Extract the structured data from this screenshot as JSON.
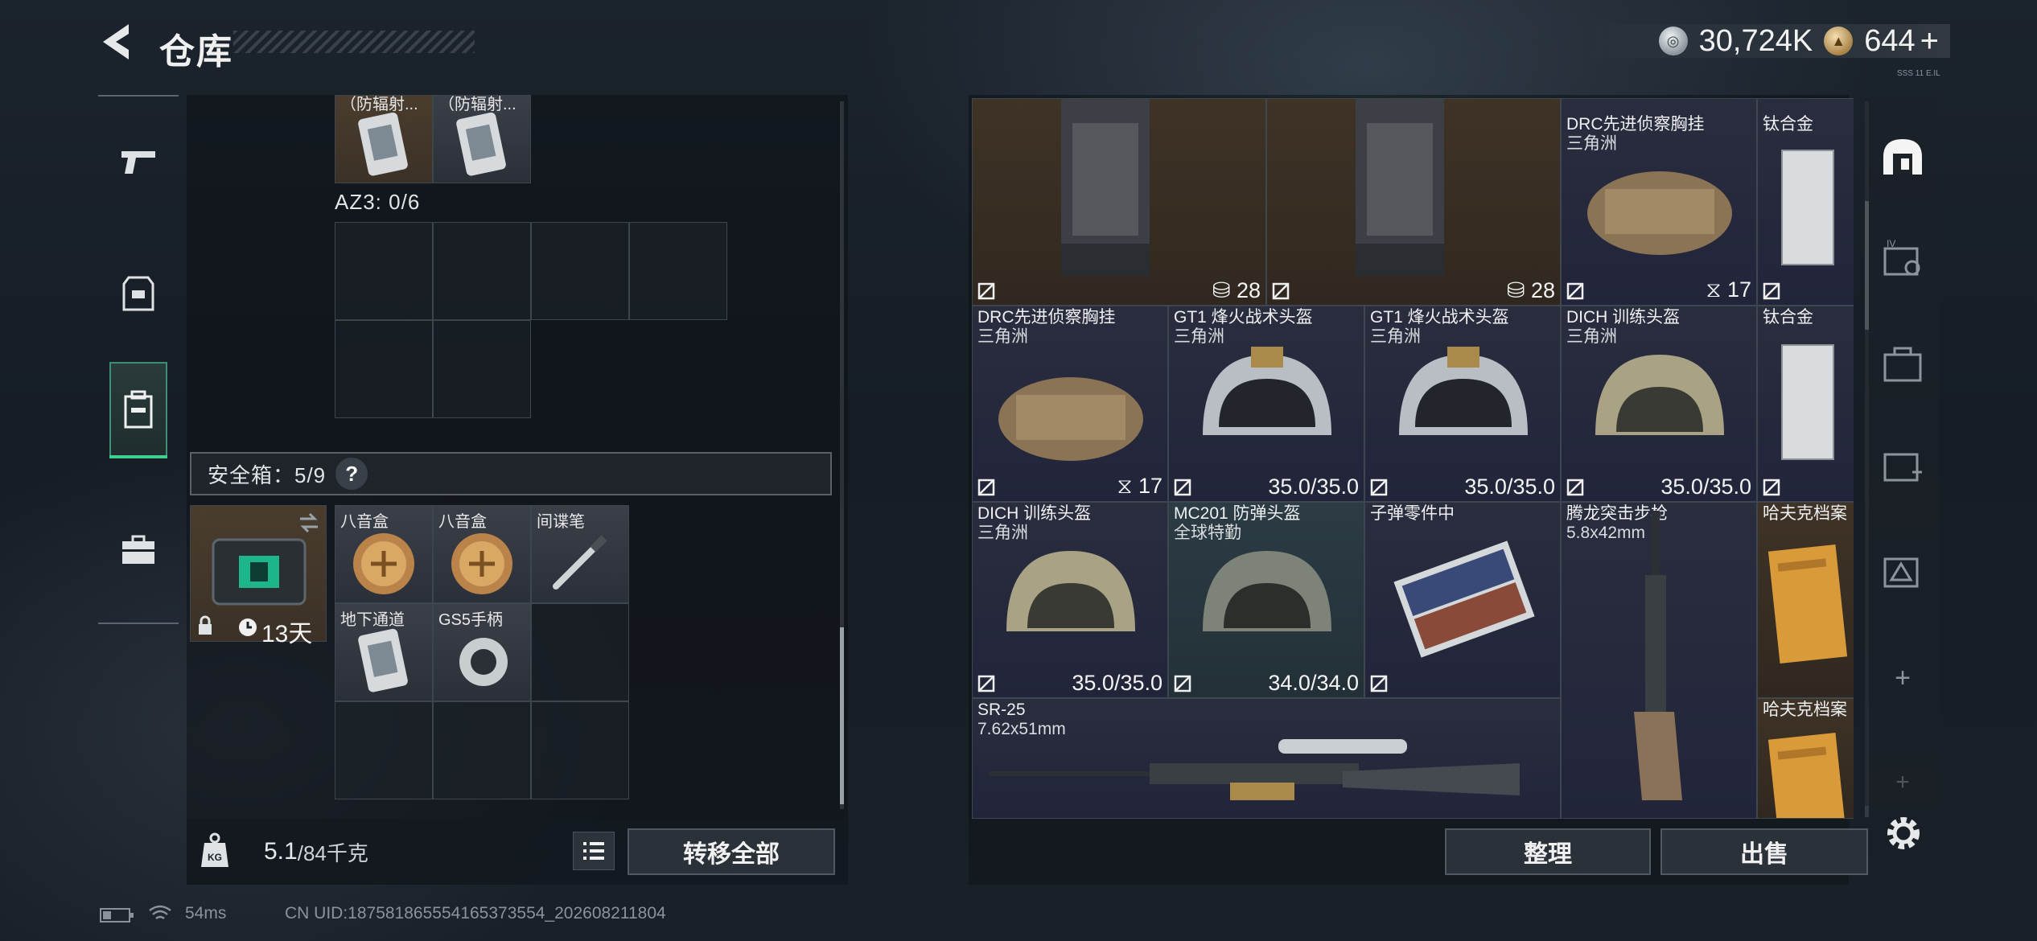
{
  "header": {
    "title": "仓库",
    "silver_amount": "30,724K",
    "gold_amount": "644",
    "gold_plus": "+",
    "tiny_note": "SSS 11 E.IL"
  },
  "left_nav": {
    "items": [
      {
        "name": "weapon",
        "icon": "pistol-icon"
      },
      {
        "name": "gear",
        "icon": "armor-icon"
      },
      {
        "name": "backpack",
        "icon": "backpack-icon",
        "active": true
      },
      {
        "name": "case",
        "icon": "briefcase-icon"
      }
    ]
  },
  "left_panel": {
    "top_items": [
      {
        "label": "（防辐射...",
        "icon": "document-card-icon"
      },
      {
        "label": "（防辐射...",
        "icon": "document-card-icon"
      }
    ],
    "az3_label": "AZ3: 0/6",
    "safebox": {
      "label": "安全箱：5/9",
      "help": "?",
      "timer": "13天",
      "items": [
        {
          "label": "八音盒",
          "icon": "music-box-icon"
        },
        {
          "label": "八音盒",
          "icon": "music-box-icon"
        },
        {
          "label": "间谍笔",
          "icon": "spy-pen-icon"
        },
        {
          "label": "地下通道",
          "icon": "document-card-icon"
        },
        {
          "label": "GS5手柄",
          "icon": "gamepad-icon"
        }
      ]
    },
    "weight": {
      "current": "5.1",
      "max": "/84千克"
    },
    "transfer_all": "转移全部"
  },
  "inventory": {
    "items": {
      "vest_a_stat": "28",
      "vest_b_stat": "28",
      "drc_top": {
        "name": "DRC先进侦察胸挂",
        "sub": "三角洲",
        "stat": "17"
      },
      "titanium_top": {
        "name": "钛合金"
      },
      "drc_mid": {
        "name": "DRC先进侦察胸挂",
        "sub": "三角洲",
        "stat": "17"
      },
      "gt1_a": {
        "name": "GT1 烽火战术头盔",
        "sub": "三角洲",
        "stat": "35.0/35.0"
      },
      "gt1_b": {
        "name": "GT1 烽火战术头盔",
        "sub": "三角洲",
        "stat": "35.0/35.0"
      },
      "dich_a": {
        "name": "DICH 训练头盔",
        "sub": "三角洲",
        "stat": "35.0/35.0"
      },
      "titanium_mid": {
        "name": "钛合金"
      },
      "dich_b": {
        "name": "DICH 训练头盔",
        "sub": "三角洲",
        "stat": "35.0/35.0"
      },
      "mc201": {
        "name": "MC201 防弹头盔",
        "sub": "全球特勤",
        "stat": "34.0/34.0"
      },
      "bullet_parts": {
        "name": "子弹零件中"
      },
      "tenglong": {
        "name": "腾龙突击步枪",
        "sub": "5.8x42mm"
      },
      "hafk_a": {
        "name": "哈夫克档案"
      },
      "hafk_b": {
        "name": "哈夫克档案"
      },
      "sr25": {
        "name": "SR-25",
        "sub": "7.62x51mm"
      }
    },
    "sort_button": "整理",
    "sell_button": "出售"
  },
  "right_nav": {
    "items": [
      {
        "icon": "safehouse-icon"
      },
      {
        "icon": "weapon-box-icon"
      },
      {
        "icon": "storage-crate-icon"
      },
      {
        "icon": "medical-box-icon"
      },
      {
        "icon": "delta-box-icon"
      },
      {
        "icon": "add-icon"
      },
      {
        "icon": "add-icon"
      }
    ],
    "add_label": "+",
    "settings_icon": "gear-icon"
  },
  "status_bar": {
    "ping": "54ms",
    "uid": "CN UID:187581865554165373554_202608211804"
  },
  "colors": {
    "active_green": "#3ecf8e",
    "purple_cell": "#2a2d3e",
    "brown_cell": "#3f3326",
    "teal_cell": "#2c3c44"
  }
}
